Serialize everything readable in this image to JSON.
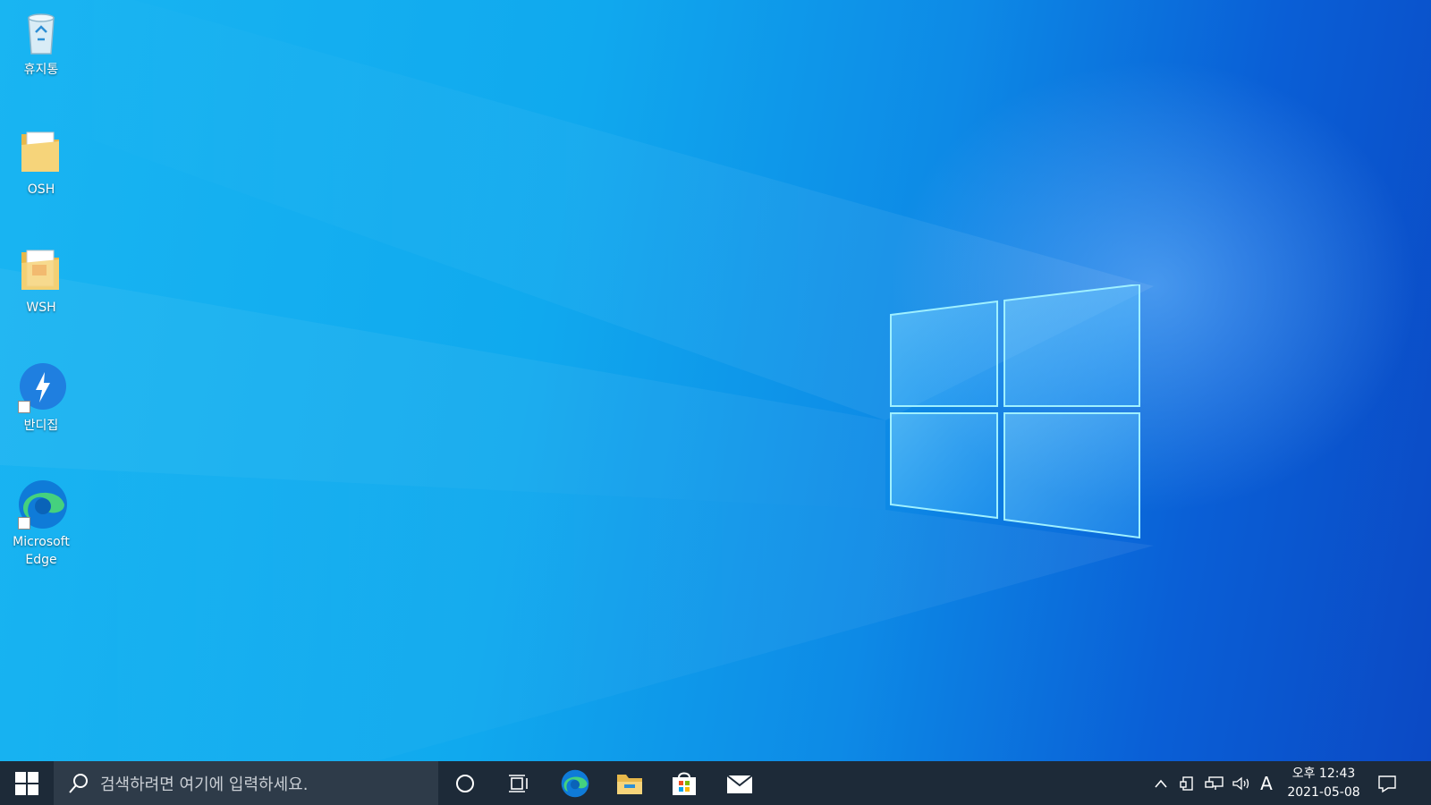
{
  "desktop": {
    "icons": [
      {
        "label": "휴지통",
        "icon": "recycle-bin-icon"
      },
      {
        "label": "OSH",
        "icon": "folder-icon"
      },
      {
        "label": "WSH",
        "icon": "folder-pdf-icon"
      },
      {
        "label": "반디집",
        "icon": "bandizip-icon"
      },
      {
        "label": "Microsoft Edge",
        "icon": "edge-icon"
      }
    ]
  },
  "taskbar": {
    "start_icon": "windows-logo-icon",
    "search_placeholder": "검색하려면 여기에 입력하세요.",
    "cortana_icon": "cortana-circle-icon",
    "task_view_icon": "task-view-icon",
    "pinned_apps": [
      {
        "name": "Microsoft Edge",
        "icon": "edge-icon"
      },
      {
        "name": "File Explorer",
        "icon": "file-explorer-icon"
      },
      {
        "name": "Microsoft Store",
        "icon": "store-icon"
      },
      {
        "name": "Mail",
        "icon": "mail-icon"
      }
    ],
    "tray": {
      "ime_label": "A",
      "time": "오후 12:43",
      "date": "2021-05-08"
    },
    "colors": {
      "taskbar_bg": "#1d2a38",
      "search_bg": "#2e3b49"
    }
  }
}
